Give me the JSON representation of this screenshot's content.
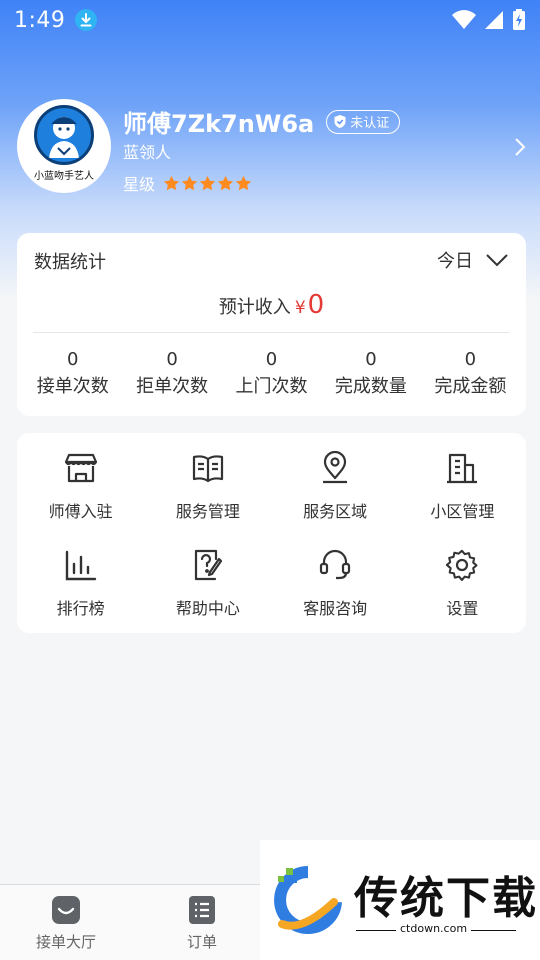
{
  "status_bar": {
    "time": "1:49"
  },
  "profile": {
    "name": "师傅7Zk7nW6a",
    "auth_badge": "未认证",
    "role": "蓝领人",
    "star_label": "星级",
    "star_count": 5,
    "avatar_caption": "小蓝吻手艺人"
  },
  "stats": {
    "title": "数据统计",
    "period": "今日",
    "income_label": "预计收入",
    "income_currency": "¥",
    "income_value": "0",
    "items": [
      {
        "value": "0",
        "label": "接单次数"
      },
      {
        "value": "0",
        "label": "拒单次数"
      },
      {
        "value": "0",
        "label": "上门次数"
      },
      {
        "value": "0",
        "label": "完成数量"
      },
      {
        "value": "0",
        "label": "完成金额"
      }
    ]
  },
  "menu": {
    "items": [
      {
        "label": "师傅入驻",
        "icon": "shop-icon"
      },
      {
        "label": "服务管理",
        "icon": "book-icon"
      },
      {
        "label": "服务区域",
        "icon": "location-pin-icon"
      },
      {
        "label": "小区管理",
        "icon": "building-icon"
      },
      {
        "label": "排行榜",
        "icon": "bar-chart-icon"
      },
      {
        "label": "帮助中心",
        "icon": "help-edit-icon"
      },
      {
        "label": "客服咨询",
        "icon": "headset-icon"
      },
      {
        "label": "设置",
        "icon": "gear-icon"
      }
    ]
  },
  "tabbar": {
    "tabs": [
      {
        "label": "接单大厅",
        "icon": "hall-icon"
      },
      {
        "label": "订单",
        "icon": "order-list-icon"
      }
    ]
  },
  "watermark": {
    "brand": "传统下载",
    "url": "ctdown.com"
  },
  "colors": {
    "primary": "#3f82f7",
    "accent_red": "#e53935",
    "star": "#ff8a1f"
  }
}
